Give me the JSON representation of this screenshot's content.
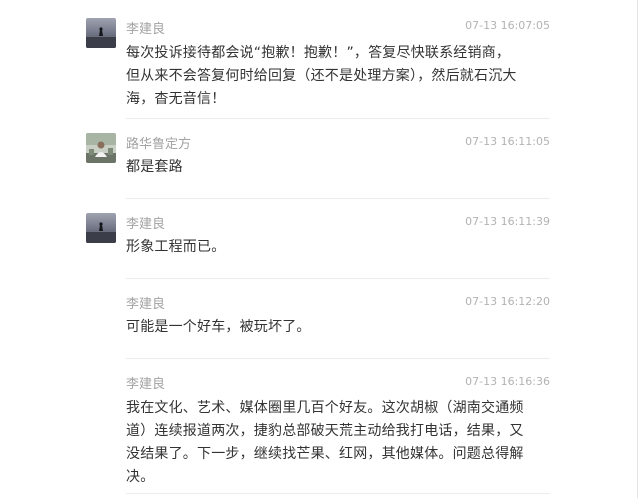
{
  "comments": [
    {
      "author": "李建良",
      "time": "07-13 16:07:05",
      "avatar_icon": "lake-silhouette-avatar",
      "lines": [
        "每次投诉接待都会说“抱歉！抱歉！”，答复尽快联系经销商，",
        "但从来不会答复何时给回复（还不是处理方案），然后就石沉大",
        "海，杳无音信！"
      ]
    },
    {
      "author": "路华鲁定方",
      "time": "07-13 16:11:05",
      "avatar_icon": "person-photo-avatar",
      "lines": [
        "都是套路"
      ]
    },
    {
      "author": "李建良",
      "time": "07-13 16:11:39",
      "avatar_icon": "lake-silhouette-avatar",
      "lines": [
        "形象工程而已。"
      ]
    },
    {
      "author": "李建良",
      "time": "07-13 16:12:20",
      "lines": [
        "可能是一个好车，被玩坏了。"
      ]
    },
    {
      "author": "李建良",
      "time": "07-13 16:16:36",
      "lines": [
        "我在文化、艺术、媒体圈里几百个好友。这次胡椒（湖南交通频",
        "道）连续报道两次，捷豹总部破天荒主动给我打电话，结果，又",
        "没结果了。下一步，继续找芒果、红网，其他媒体。问题总得解",
        "决。"
      ]
    }
  ]
}
